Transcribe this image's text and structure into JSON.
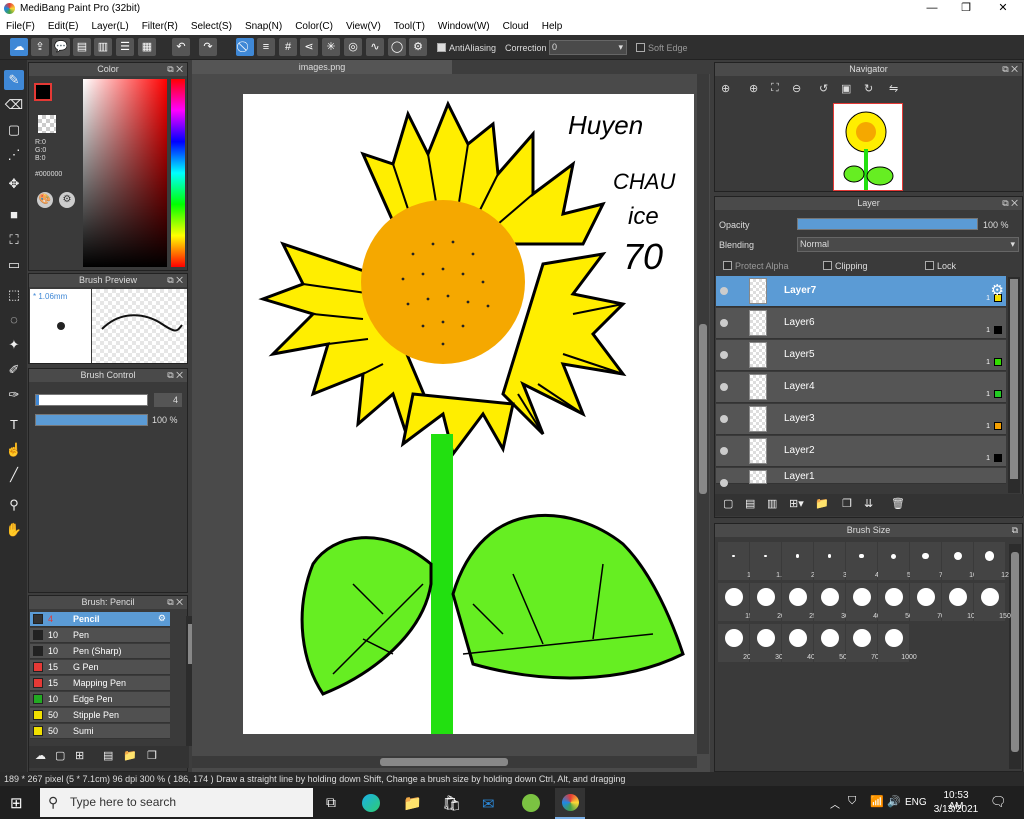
{
  "app": {
    "title": "MediBang Paint Pro (32bit)",
    "minimize": "—",
    "restore": "❐",
    "close": "✕"
  },
  "menu": [
    "File(F)",
    "Edit(E)",
    "Layer(L)",
    "Filter(R)",
    "Select(S)",
    "Snap(N)",
    "Color(C)",
    "View(V)",
    "Tool(T)",
    "Window(W)",
    "Cloud",
    "Help"
  ],
  "toolbar": {
    "antialiasing": "AntiAliasing",
    "correction_label": "Correction",
    "correction_value": "0",
    "soft_edge": "Soft Edge"
  },
  "color_panel": {
    "title": "Color",
    "rgb": "R:0\nG:0\nB:0",
    "hex": "#000000"
  },
  "brush_preview": {
    "title": "Brush Preview",
    "size": "* 1.06mm"
  },
  "brush_control": {
    "title": "Brush Control",
    "size": "4",
    "opacity": "100 %"
  },
  "brush_list": {
    "title": "Brush: Pencil",
    "items": [
      {
        "size": "4",
        "name": "Pencil",
        "color": "#333333"
      },
      {
        "size": "10",
        "name": "Pen",
        "color": "#222222"
      },
      {
        "size": "10",
        "name": "Pen (Sharp)",
        "color": "#222222"
      },
      {
        "size": "15",
        "name": "G Pen",
        "color": "#e53935"
      },
      {
        "size": "15",
        "name": "Mapping Pen",
        "color": "#e53935"
      },
      {
        "size": "10",
        "name": "Edge Pen",
        "color": "#22aa22"
      },
      {
        "size": "50",
        "name": "Stipple Pen",
        "color": "#f1e000"
      },
      {
        "size": "50",
        "name": "Sumi",
        "color": "#f1e000"
      }
    ]
  },
  "document": {
    "tab": "images.png"
  },
  "navigator": {
    "title": "Navigator"
  },
  "layer_panel": {
    "title": "Layer",
    "opacity_label": "Opacity",
    "opacity_value": "100 %",
    "opacity": 1.0,
    "blending_label": "Blending",
    "blending_value": "Normal",
    "protect_alpha": "Protect Alpha",
    "clipping": "Clipping",
    "lock": "Lock",
    "layers": [
      {
        "name": "Layer7",
        "count": "1",
        "swatch": "#f5e000",
        "selected": true
      },
      {
        "name": "Layer6",
        "count": "1",
        "swatch": "#000000",
        "selected": false
      },
      {
        "name": "Layer5",
        "count": "1",
        "swatch": "#33dd00",
        "selected": false
      },
      {
        "name": "Layer4",
        "count": "1",
        "swatch": "#22cc22",
        "selected": false
      },
      {
        "name": "Layer3",
        "count": "1",
        "swatch": "#f5a000",
        "selected": false
      },
      {
        "name": "Layer2",
        "count": "1",
        "swatch": "#000000",
        "selected": false
      },
      {
        "name": "Layer1",
        "count": "",
        "swatch": "",
        "selected": false
      }
    ]
  },
  "brush_size": {
    "title": "Brush Size",
    "sizes": [
      "1",
      "1.5",
      "2",
      "3",
      "4",
      "5",
      "7",
      "10",
      "12",
      "15",
      "20",
      "25",
      "30",
      "40",
      "50",
      "70",
      "100",
      "150",
      "200",
      "300",
      "400",
      "500",
      "700",
      "1000"
    ]
  },
  "status": {
    "text": "189 * 267 pixel   (5 * 7.1cm)   96 dpi   300 %   ( 186, 174 )   Draw a straight line by holding down Shift, Change a brush size by holding down Ctrl, Alt, and dragging"
  },
  "taskbar": {
    "search_placeholder": "Type here to search",
    "language": "ENG",
    "time": "10:53 AM",
    "date": "3/13/2021"
  },
  "handwriting": {
    "lines": [
      "Huyen",
      "CHAU",
      "ice",
      "70"
    ]
  }
}
